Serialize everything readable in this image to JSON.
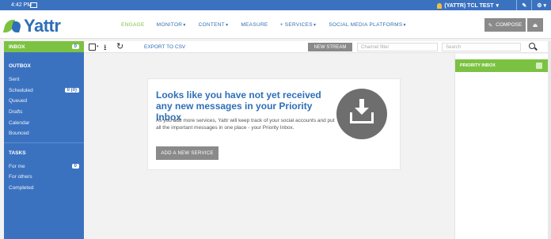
{
  "system_bar": {
    "time": "4:42 PM",
    "user": "(YATTR) TCL TEST",
    "user_caret": "▾",
    "tool1": "✎",
    "tool2": "⚙ ▾"
  },
  "header": {
    "logo": "Yattr",
    "nav": [
      {
        "label": "ENGAGE",
        "caret": ""
      },
      {
        "label": "MONITOR",
        "caret": "▼"
      },
      {
        "label": "CONTENT",
        "caret": "▼"
      },
      {
        "label": "MEASURE",
        "caret": ""
      },
      {
        "label": "+ SERVICES",
        "caret": "▼"
      },
      {
        "label": "SOCIAL MEDIA PLATFORMS",
        "caret": "▼"
      }
    ],
    "compose_icon": "✎",
    "compose_label": "COMPOSE",
    "compose_side_icon": "⏏"
  },
  "sidebar": {
    "inbox_label": "INBOX",
    "inbox_badge": "0",
    "outbox_title": "OUTBOX",
    "outbox_items": [
      {
        "label": "Sent",
        "badge": ""
      },
      {
        "label": "Scheduled",
        "badge": "0 (0)"
      },
      {
        "label": "Queued",
        "badge": ""
      },
      {
        "label": "Drafts",
        "badge": ""
      },
      {
        "label": "Calendar",
        "badge": ""
      },
      {
        "label": "Bounced",
        "badge": ""
      }
    ],
    "tasks_title": "TASKS",
    "task_items": [
      {
        "label": "For me",
        "badge": "0"
      },
      {
        "label": "For others",
        "badge": ""
      },
      {
        "label": "Completed",
        "badge": ""
      }
    ]
  },
  "toolbar": {
    "caret": "▾",
    "download_icon": "⭳",
    "refresh_icon": "↻",
    "export_label": "EXPORT TO CSV",
    "new_stream_label": "NEW STREAM",
    "channel_filter_placeholder": "Channel filter",
    "search_placeholder": "Search"
  },
  "empty_state": {
    "title": "Looks like you have not yet received any new messages in your Priority Inbox",
    "body": "As you add more services, Yattr will keep track of your social accounts and put all the important messages in one place - your Priority Inbox.",
    "button_label": "ADD A NEW SERVICE"
  },
  "right_panel": {
    "title": "PRIORITY INBOX"
  },
  "colors": {
    "brand_blue": "#3b72c0",
    "brand_green": "#7cc242",
    "button_gray": "#8a8a8a"
  }
}
